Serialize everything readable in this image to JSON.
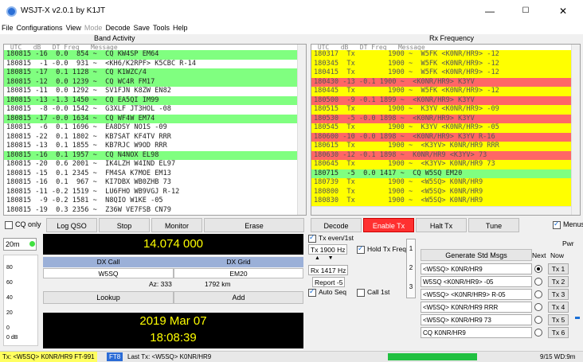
{
  "window": {
    "title": "WSJT-X  v2.0.1  by K1JT",
    "min": "—",
    "max": "☐",
    "close": "✕"
  },
  "menu": [
    "File",
    "Configurations",
    "View",
    "Mode",
    "Decode",
    "Save",
    "Tools",
    "Help"
  ],
  "band_activity": {
    "title": "Band Activity",
    "header": " UTC   dB   DT Freq   Message",
    "rows": [
      {
        "text": "180815 -16  0.0  854 ~  CQ KW4SP EM64",
        "hl": "green"
      },
      {
        "text": "180815  -1 -0.0  931 ~  <KH6/K2RPF> K5CBC R-14",
        "hl": ""
      },
      {
        "text": "180815 -17  0.1 1128 ~  CQ K1WZC/4",
        "hl": "green"
      },
      {
        "text": "180815 -12  0.0 1239 ~  CQ WC4R FM17",
        "hl": "green"
      },
      {
        "text": "180815 -11  0.0 1292 ~  SV1FJN K8ZW EN82",
        "hl": ""
      },
      {
        "text": "180815 -13 -1.3 1450 ~  CQ EA5QI IM99",
        "hl": "green"
      },
      {
        "text": "180815  -8 -0.0 1542 ~  G3XLF JT3HOL -08",
        "hl": ""
      },
      {
        "text": "180815 -17 -0.0 1634 ~  CQ WF4W EM74",
        "hl": "green"
      },
      {
        "text": "180815  -6  0.1 1696 ~  EA8DSY NO1S -09",
        "hl": ""
      },
      {
        "text": "180815 -22  0.1 1802 ~  KB7SAT KF4TV RRR",
        "hl": ""
      },
      {
        "text": "180815 -13  0.1 1855 ~  KB7RJC W9OD RRR",
        "hl": ""
      },
      {
        "text": "180815 -16  0.1 1957 ~  CQ N4NOX EL98",
        "hl": "green"
      },
      {
        "text": "180815 -20  0.6 2001 ~  IK4LZH W4IND EL97",
        "hl": ""
      },
      {
        "text": "180815 -15  0.1 2345 ~  FM4SA K7MOE EM13",
        "hl": ""
      },
      {
        "text": "180815 -16  0.1  967 ~  KI7DBX WB0ZHB 73",
        "hl": ""
      },
      {
        "text": "180815 -11 -0.2 1519 ~  LU6FHO WB9VGJ R-12",
        "hl": ""
      },
      {
        "text": "180815  -9 -0.2 1581 ~  N8QIO W1KE -05",
        "hl": ""
      },
      {
        "text": "180815 -19  0.3 2356 ~  Z36W VE7FSB CN79",
        "hl": ""
      }
    ]
  },
  "rx_frequency": {
    "title": "Rx Frequency",
    "header": " UTC   dB   DT Freq   Message",
    "rows": [
      {
        "text": "180317  Tx        1900 ~  W5FK <K0NR/HR9> -12",
        "hl": "yellow"
      },
      {
        "text": "180345  Tx        1900 ~  W5FK <K0NR/HR9> -12",
        "hl": "yellow"
      },
      {
        "text": "180415  Tx        1900 ~  W5FK <K0NR/HR9> -12",
        "hl": "yellow"
      },
      {
        "text": "180430 -13 -0.1 1900 ~  <K0NR/HR9> K3YV",
        "hl": "red"
      },
      {
        "text": "180445  Tx        1900 ~  W5FK <K0NR/HR9> -12",
        "hl": "yellow"
      },
      {
        "text": "180500  -9 -0.1 1899 ~  <K0NR/HR9> K3YV",
        "hl": "red"
      },
      {
        "text": "180515  Tx        1900 ~  K3YV <K0NR/HR9> -09",
        "hl": "yellow"
      },
      {
        "text": "180530  -5 -0.0 1898 ~  <K0NR/HR9> K3YV",
        "hl": "red"
      },
      {
        "text": "180545  Tx        1900 ~  K3YV <K0NR/HR9> -05",
        "hl": "yellow"
      },
      {
        "text": "180600 -10 -0.0 1898 ~  <K0NR/HR9> K3YV R-16",
        "hl": "red"
      },
      {
        "text": "180615  Tx        1900 ~  <K3YV> K0NR/HR9 RRR",
        "hl": "yellow"
      },
      {
        "text": "180630 -12 -0.1 1898 ~  K0NR/HR9 <K3YV> 73",
        "hl": "red"
      },
      {
        "text": "180645  Tx        1900 ~  <K3YV> K0NR/HR9 73",
        "hl": "yellow"
      },
      {
        "text": "180715  -5  0.0 1417 ~  CQ W5SQ EM20",
        "hl": "green"
      },
      {
        "text": "180739  Tx        1900 ~  <W5SQ> K0NR/HR9",
        "hl": "yellow"
      },
      {
        "text": "180800  Tx        1900 ~  <W5SQ> K0NR/HR9",
        "hl": "yellow"
      },
      {
        "text": "180830  Tx        1900 ~  <W5SQ> K0NR/HR9",
        "hl": "yellow"
      }
    ]
  },
  "buttons": {
    "cq_only": "CQ only",
    "log_qso": "Log QSO",
    "stop": "Stop",
    "monitor": "Monitor",
    "erase": "Erase",
    "decode": "Decode",
    "enable_tx": "Enable Tx",
    "halt_tx": "Halt Tx",
    "tune": "Tune",
    "menus": "Menus"
  },
  "band": "20m",
  "frequency": "14.074 000",
  "dx": {
    "call_label": "DX Call",
    "grid_label": "DX Grid",
    "call": "W5SQ",
    "grid": "EM20",
    "az": "Az: 333",
    "dist": "1792 km",
    "lookup": "Lookup",
    "add": "Add"
  },
  "clock": {
    "date": "2019 Mar 07",
    "time": "18:08:39"
  },
  "meter": {
    "ticks": [
      "80",
      "60",
      "40",
      "20",
      "0"
    ],
    "label": "0 dB"
  },
  "controls": {
    "tx_even": "Tx even/1st",
    "tx_hz": "Tx  1900  Hz",
    "hold_tx": "Hold Tx Freq",
    "rx_hz": "Rx  1417  Hz",
    "report": "Report  -5",
    "auto_seq": "Auto Seq",
    "call_1st": "Call 1st"
  },
  "tabs": [
    "1",
    "2",
    "3"
  ],
  "gen_msgs": {
    "button": "Generate Std Msgs",
    "next": "Next",
    "now": "Now",
    "msgs": [
      "<W5SQ> K0NR/HR9",
      "W5SQ <K0NR/HR9> -05",
      "<W5SQ> <K0NR/HR9> R-05",
      "<W5SQ> K0NR/HR9 RRR",
      "<W5SQ> K0NR/HR9 73",
      "CQ K0NR/HR9"
    ],
    "tx": [
      "Tx 1",
      "Tx 2",
      "Tx 3",
      "Tx 4",
      "Tx 5",
      "Tx 6"
    ]
  },
  "pwr": "Pwr",
  "status": {
    "tx": "Tx: <W5SQ> K0NR/HR9 FT-991",
    "mode": "FT8",
    "last_tx": "Last Tx: <W5SQ> K0NR/HR9",
    "right": "9/15  WD:9m"
  }
}
